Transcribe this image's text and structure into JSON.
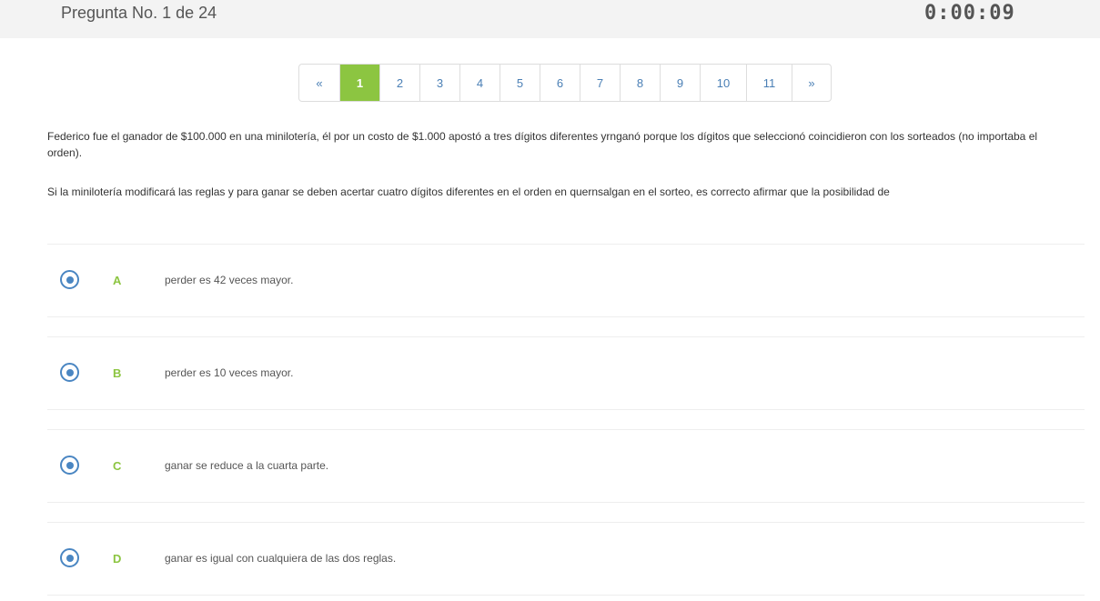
{
  "header": {
    "question_counter": "Pregunta No. 1 de 24",
    "timer": "0:00:09"
  },
  "pagination": {
    "prev": "«",
    "next": "»",
    "pages": [
      "1",
      "2",
      "3",
      "4",
      "5",
      "6",
      "7",
      "8",
      "9",
      "10",
      "11"
    ],
    "active": "1"
  },
  "question": {
    "paragraph1": "Federico fue el ganador de $100.000 en una minilotería, él por un costo de $1.000 apostó a tres dígitos diferentes yrnganó porque los dígitos que seleccionó coincidieron con los sorteados (no importaba el orden).",
    "paragraph2": "Si la minilotería modificará las reglas y para ganar se deben acertar cuatro dígitos diferentes en el orden en quernsalgan en el sorteo, es correcto afirmar que la posibilidad de"
  },
  "options": [
    {
      "letter": "A",
      "text": "perder es 42 veces mayor."
    },
    {
      "letter": "B",
      "text": "perder es 10 veces mayor."
    },
    {
      "letter": "C",
      "text": "ganar se reduce a la cuarta parte."
    },
    {
      "letter": "D",
      "text": "ganar es igual con cualquiera de las dos reglas."
    }
  ],
  "colors": {
    "accent_green": "#8cc541",
    "link_blue": "#4a7fb5",
    "radio_blue": "#4a86c2",
    "topbar_bg": "#f3f3f3"
  }
}
